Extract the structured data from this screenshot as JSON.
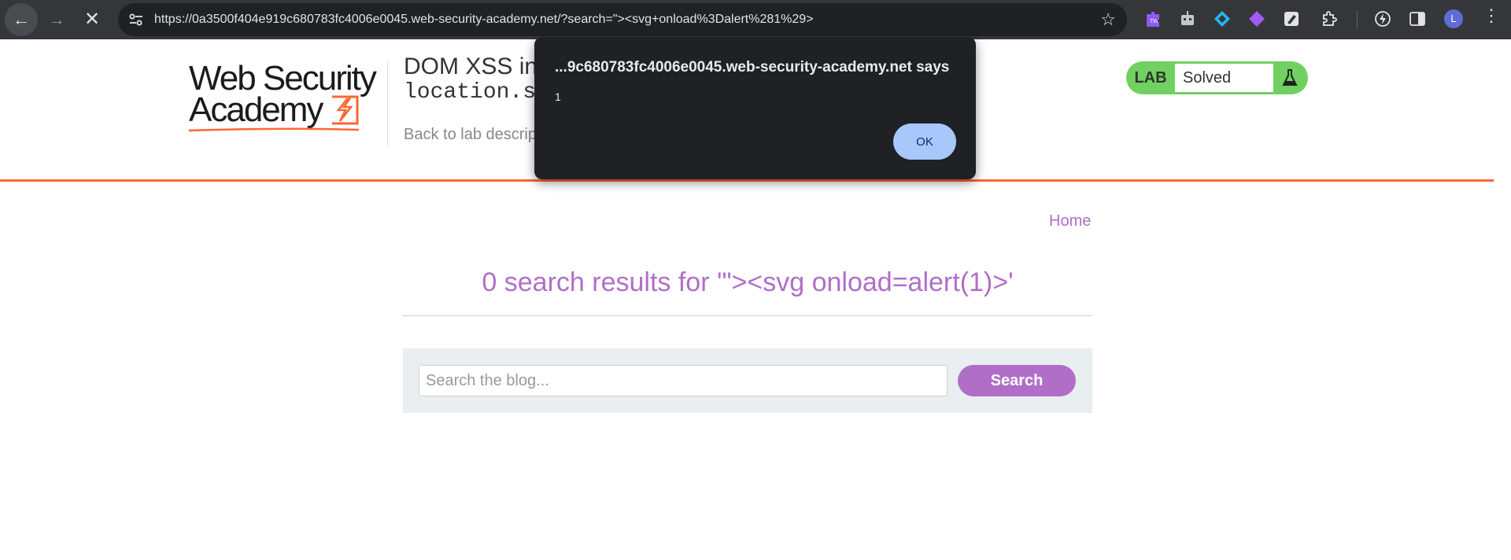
{
  "browser": {
    "url": "https://0a3500f404e919c680783fc4006e0045.web-security-academy.net/?search=\"><svg+onload%3Dalert%281%29>",
    "avatar_initial": "L",
    "extensions": [
      "tw-extension-icon",
      "robot-extension-icon",
      "diamond-extension-icon",
      "gem-extension-icon",
      "pen-extension-icon",
      "puzzle-extensions-icon",
      "performance-icon",
      "side-panel-icon"
    ]
  },
  "header": {
    "logo_line1": "Web Security",
    "logo_line2": "Academy",
    "lab_title": "DOM XSS in",
    "lab_title_code": "location.s",
    "back_link": "Back to lab descrip",
    "lab_badge_label": "LAB",
    "lab_status": "Solved",
    "colors": {
      "accent_orange": "#ff6633",
      "solved_green": "#70d160"
    }
  },
  "main": {
    "home_link": "Home",
    "results_heading": "0 search results for '\"><svg onload=alert(1)>'",
    "search_placeholder": "Search the blog...",
    "search_button": "Search",
    "colors": {
      "link_purple": "#b06ec8",
      "panel_bg": "#e9eef0"
    }
  },
  "dialog": {
    "title": "...9c680783fc4006e0045.web-security-academy.net says",
    "message": "1",
    "ok_label": "OK"
  }
}
